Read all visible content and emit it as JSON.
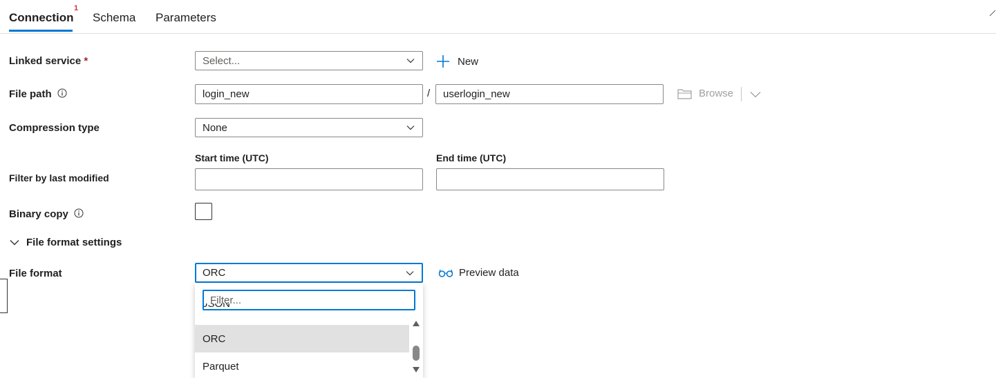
{
  "tabs": {
    "connection": "Connection",
    "connection_badge": "1",
    "schema": "Schema",
    "parameters": "Parameters"
  },
  "linked_service": {
    "label": "Linked service",
    "required_mark": "*",
    "placeholder": "Select...",
    "new_label": "New"
  },
  "file_path": {
    "label": "File path",
    "container": "login_new",
    "separator": "/",
    "file": "userlogin_new",
    "browse_label": "Browse"
  },
  "compression": {
    "label": "Compression type",
    "value": "None"
  },
  "filter_modified": {
    "label": "Filter by last modified",
    "start_label": "Start time (UTC)",
    "end_label": "End time (UTC)",
    "start_value": "",
    "end_value": ""
  },
  "binary_copy": {
    "label": "Binary copy",
    "checked": false
  },
  "file_format_settings": {
    "label": "File format settings"
  },
  "file_format": {
    "label": "File format",
    "value": "ORC",
    "preview_label": "Preview data",
    "filter_placeholder": "Filter...",
    "options": [
      "JSON",
      "ORC",
      "Parquet"
    ],
    "selected": "ORC"
  },
  "colors": {
    "accent": "#0078d4",
    "required": "#a4262c",
    "badge": "#d13438",
    "selected_bg": "#e1e1e1"
  },
  "icons": {
    "info": "info-icon",
    "chevron": "chevron-down-icon",
    "plus": "plus-icon",
    "folder": "folder-icon",
    "glasses": "glasses-icon"
  }
}
